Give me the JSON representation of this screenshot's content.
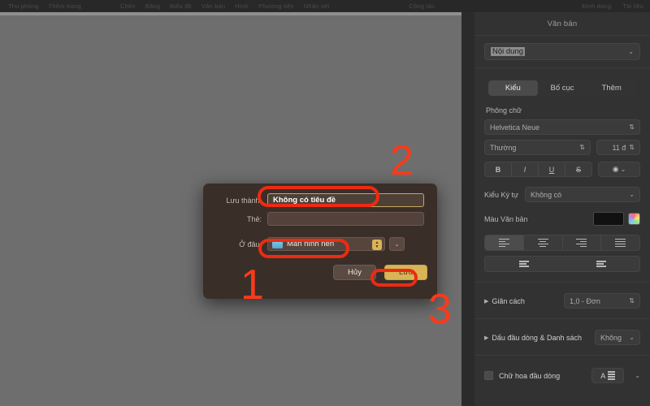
{
  "menubar": {
    "left": [
      "Thu phóng",
      "Thêm trang"
    ],
    "middle": [
      "Chèn",
      "Bảng",
      "Biểu đồ",
      "Văn bản",
      "Hình",
      "Phương tiện",
      "Nhận xét"
    ],
    "collaborate": "Cộng tác",
    "right": [
      "Định dạng",
      "Tài liệu"
    ]
  },
  "dialog": {
    "save_as_label": "Lưu thành:",
    "save_as_value": "Không có tiêu đề",
    "tags_label": "Thẻ:",
    "tags_value": "",
    "where_label": "Ở đâu:",
    "where_value": "Màn hình nền",
    "where_icon": "folder-icon",
    "stepper_icon": "stepper-updown-icon",
    "expand_icon": "chevron-down-icon",
    "cancel_label": "Hủy",
    "save_label": "Lưu"
  },
  "annotations": {
    "color": "#f93a1b",
    "steps": [
      "1",
      "2",
      "3"
    ]
  },
  "inspector": {
    "title": "Văn bản",
    "content_popup": "Nội dung",
    "tabs": [
      {
        "label": "Kiểu",
        "active": true
      },
      {
        "label": "Bố cục",
        "active": false
      },
      {
        "label": "Thêm",
        "active": false
      }
    ],
    "font_section_label": "Phông chữ",
    "font_family": "Helvetica Neue",
    "font_weight": "Thường",
    "font_size": "11 đ",
    "style_buttons": [
      "B",
      "I",
      "U",
      "S"
    ],
    "more_style_icon": "text-effects-icon",
    "char_style_label": "Kiểu Ký tự",
    "char_style_value": "Không có",
    "text_color_label": "Màu Văn bản",
    "text_color_swatch": "#111111",
    "alignment_icons": [
      "align-left-icon",
      "align-center-icon",
      "align-right-icon",
      "align-justify-icon"
    ],
    "indent_icons": [
      "outdent-icon",
      "indent-icon"
    ],
    "spacing_label": "Giãn cách",
    "spacing_value": "1,0 - Đơn",
    "bullets_label": "Dấu đầu dòng & Danh sách",
    "bullets_value": "Không",
    "dropcap_label": "Chữ hoa đầu dòng",
    "dropcap_button_icon": "drop-cap-icon"
  }
}
